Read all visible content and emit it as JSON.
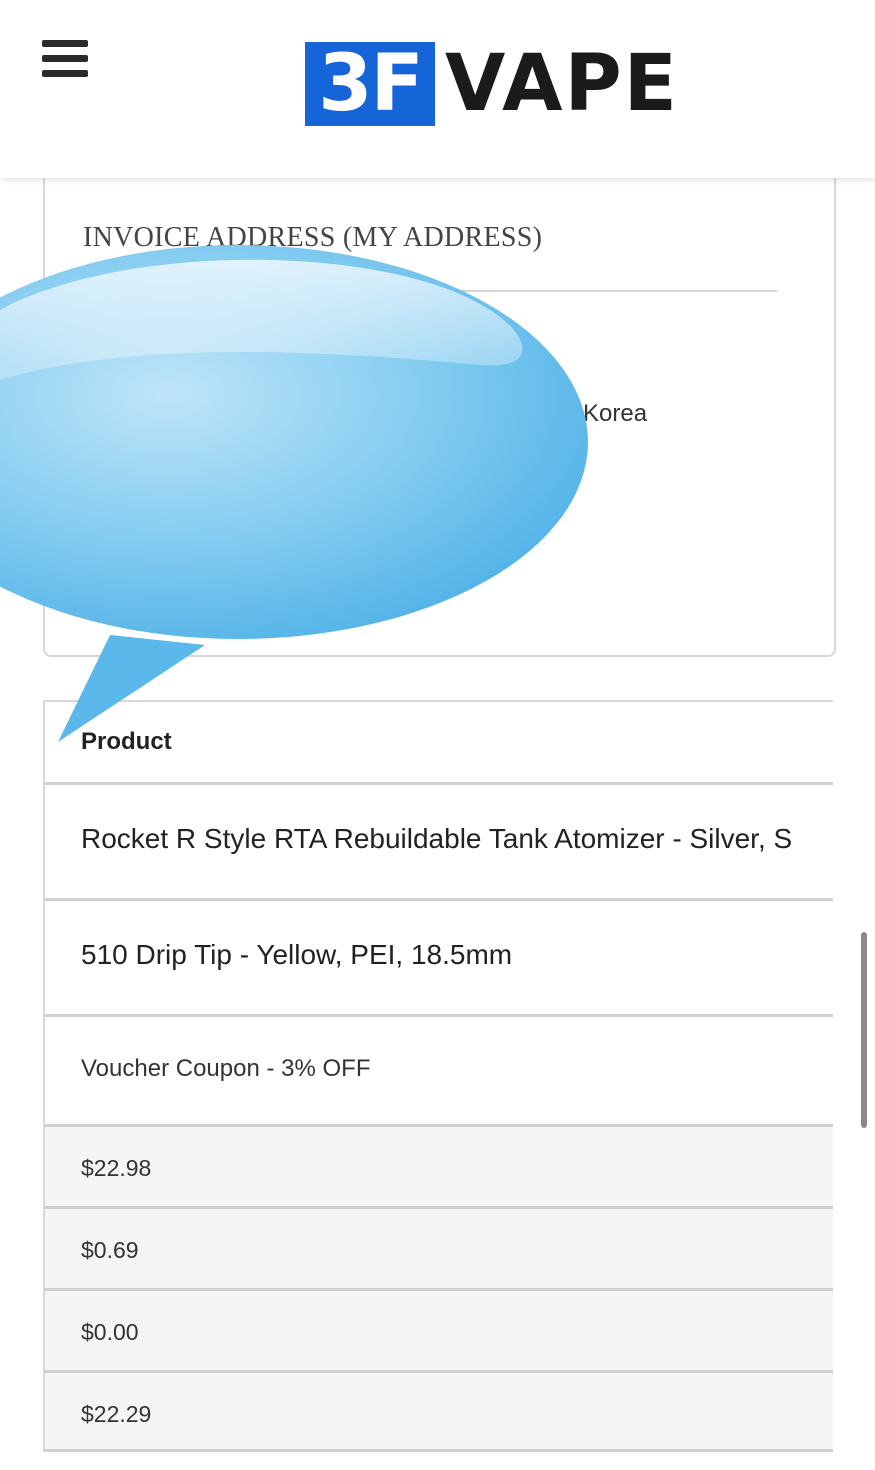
{
  "header": {
    "menu_icon": "hamburger-menu-icon",
    "logo_box_text": "3F",
    "logo_word": "VAPE",
    "colors": {
      "logo_blue": "#1565d8",
      "logo_text": "#1b1b1b"
    }
  },
  "invoice": {
    "title": "INVOICE ADDRESS (MY ADDRESS)",
    "country_fragment": "Korea"
  },
  "overlay": {
    "icon": "speech-bubble-icon",
    "color": "#6ec6f0"
  },
  "order": {
    "header": "Product",
    "items": [
      "Rocket R Style RTA Rebuildable Tank Atomizer - Silver, S",
      "510 Drip Tip - Yellow, PEI, 18.5mm"
    ],
    "coupon": "Voucher Coupon - 3% OFF",
    "totals": [
      "$22.98",
      "$0.69",
      "$0.00",
      "$22.29"
    ]
  }
}
